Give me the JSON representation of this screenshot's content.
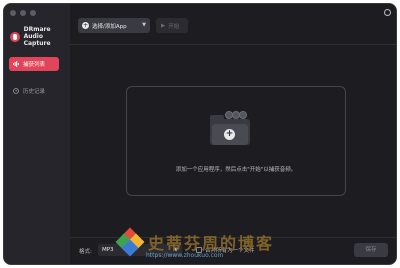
{
  "app": {
    "brand_line1": "DRmare",
    "brand_line2": "Audio Capture"
  },
  "sidebar": {
    "items": [
      {
        "label": "捕获列表",
        "icon": "waveform-icon",
        "active": true
      },
      {
        "label": "历史记录",
        "icon": "clock-icon",
        "active": false
      }
    ]
  },
  "toolbar": {
    "select_label": "选择/添加App",
    "start_label": "开始"
  },
  "dropzone": {
    "hint": "添加一个应用程序，然后点击\"开始\"以捕获音频。"
  },
  "footer": {
    "format_label": "格式:",
    "format_value": "MP3",
    "merge_label": "合并所有为一个文件",
    "save_label": "保存"
  },
  "watermark": {
    "text": "史蒂芬周的博客",
    "url": "https://www.zhoukuo.com"
  },
  "colors": {
    "accent": "#e2455a",
    "background": "#1c1c21",
    "sidebar": "#25252b"
  }
}
